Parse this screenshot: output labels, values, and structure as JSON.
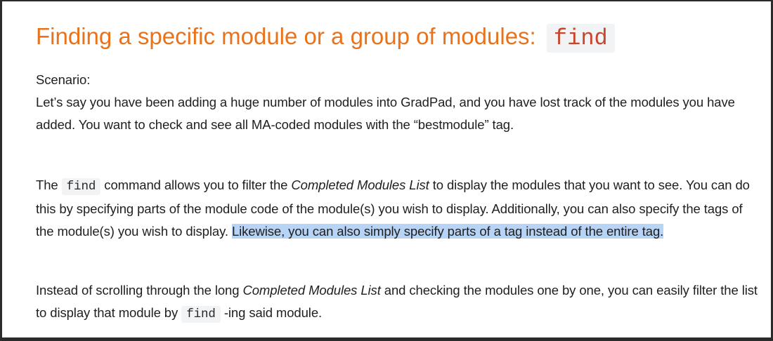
{
  "heading": {
    "text": "Finding a specific module or a group of modules:",
    "code": "find"
  },
  "paragraph1": {
    "label": "Scenario:",
    "text": "Let’s say you have been adding a huge number of modules into GradPad, and you have lost track of the modules you have added. You want to check and see all MA-coded modules with the “bestmodule” tag."
  },
  "paragraph2": {
    "part1": "The",
    "code": "find",
    "part2": "command allows you to filter the",
    "emph": "Completed Modules List",
    "part3": "to display the modules that you want to see. You can do this by specifying parts of the module code of the module(s) you wish to display. Additionally, you can also specify the tags of the module(s) you wish to display.",
    "highlighted": "Likewise, you can also simply specify parts of a tag instead of the entire tag."
  },
  "paragraph3": {
    "part1": "Instead of scrolling through the long",
    "emph": "Completed Modules List",
    "part2": "and checking the modules one by one, you can easily filter the list to display that module by",
    "code": "find",
    "part3": "-ing said module."
  },
  "colors": {
    "heading": "#e8731c",
    "highlight": "#b7d3f5",
    "code_background": "#f1f3f5"
  }
}
